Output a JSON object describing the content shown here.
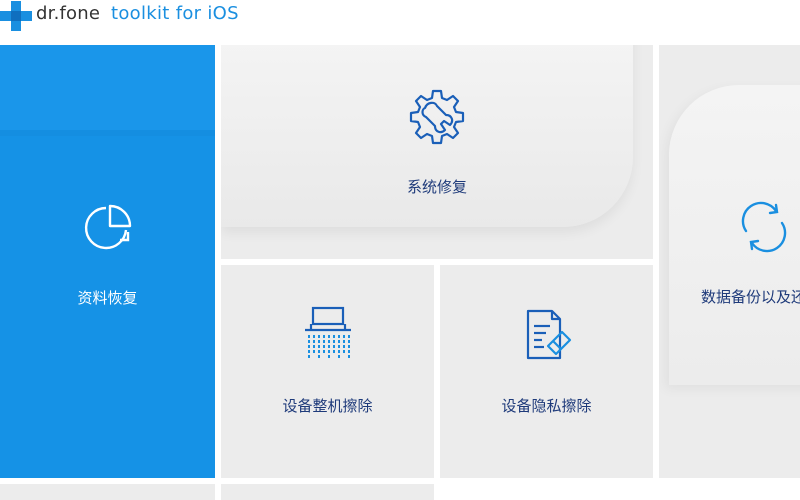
{
  "app": {
    "brand": "dr.fone",
    "subtitle": "toolkit for iOS"
  },
  "tiles": {
    "recovery": {
      "label": "资料恢复",
      "icon": "pie-chart-icon"
    },
    "repair": {
      "label": "系统修复",
      "icon": "gear-wrench-icon"
    },
    "backup": {
      "label": "数据备份以及还",
      "icon": "sync-icon"
    },
    "erase_full": {
      "label": "设备整机擦除",
      "icon": "shredder-icon"
    },
    "erase_private": {
      "label": "设备隐私擦除",
      "icon": "document-eraser-icon"
    }
  },
  "colors": {
    "accent": "#1592e6",
    "tile_bg": "#ececec",
    "label_text": "#1e3a7a",
    "icon_blue": "#1a5fb8"
  }
}
